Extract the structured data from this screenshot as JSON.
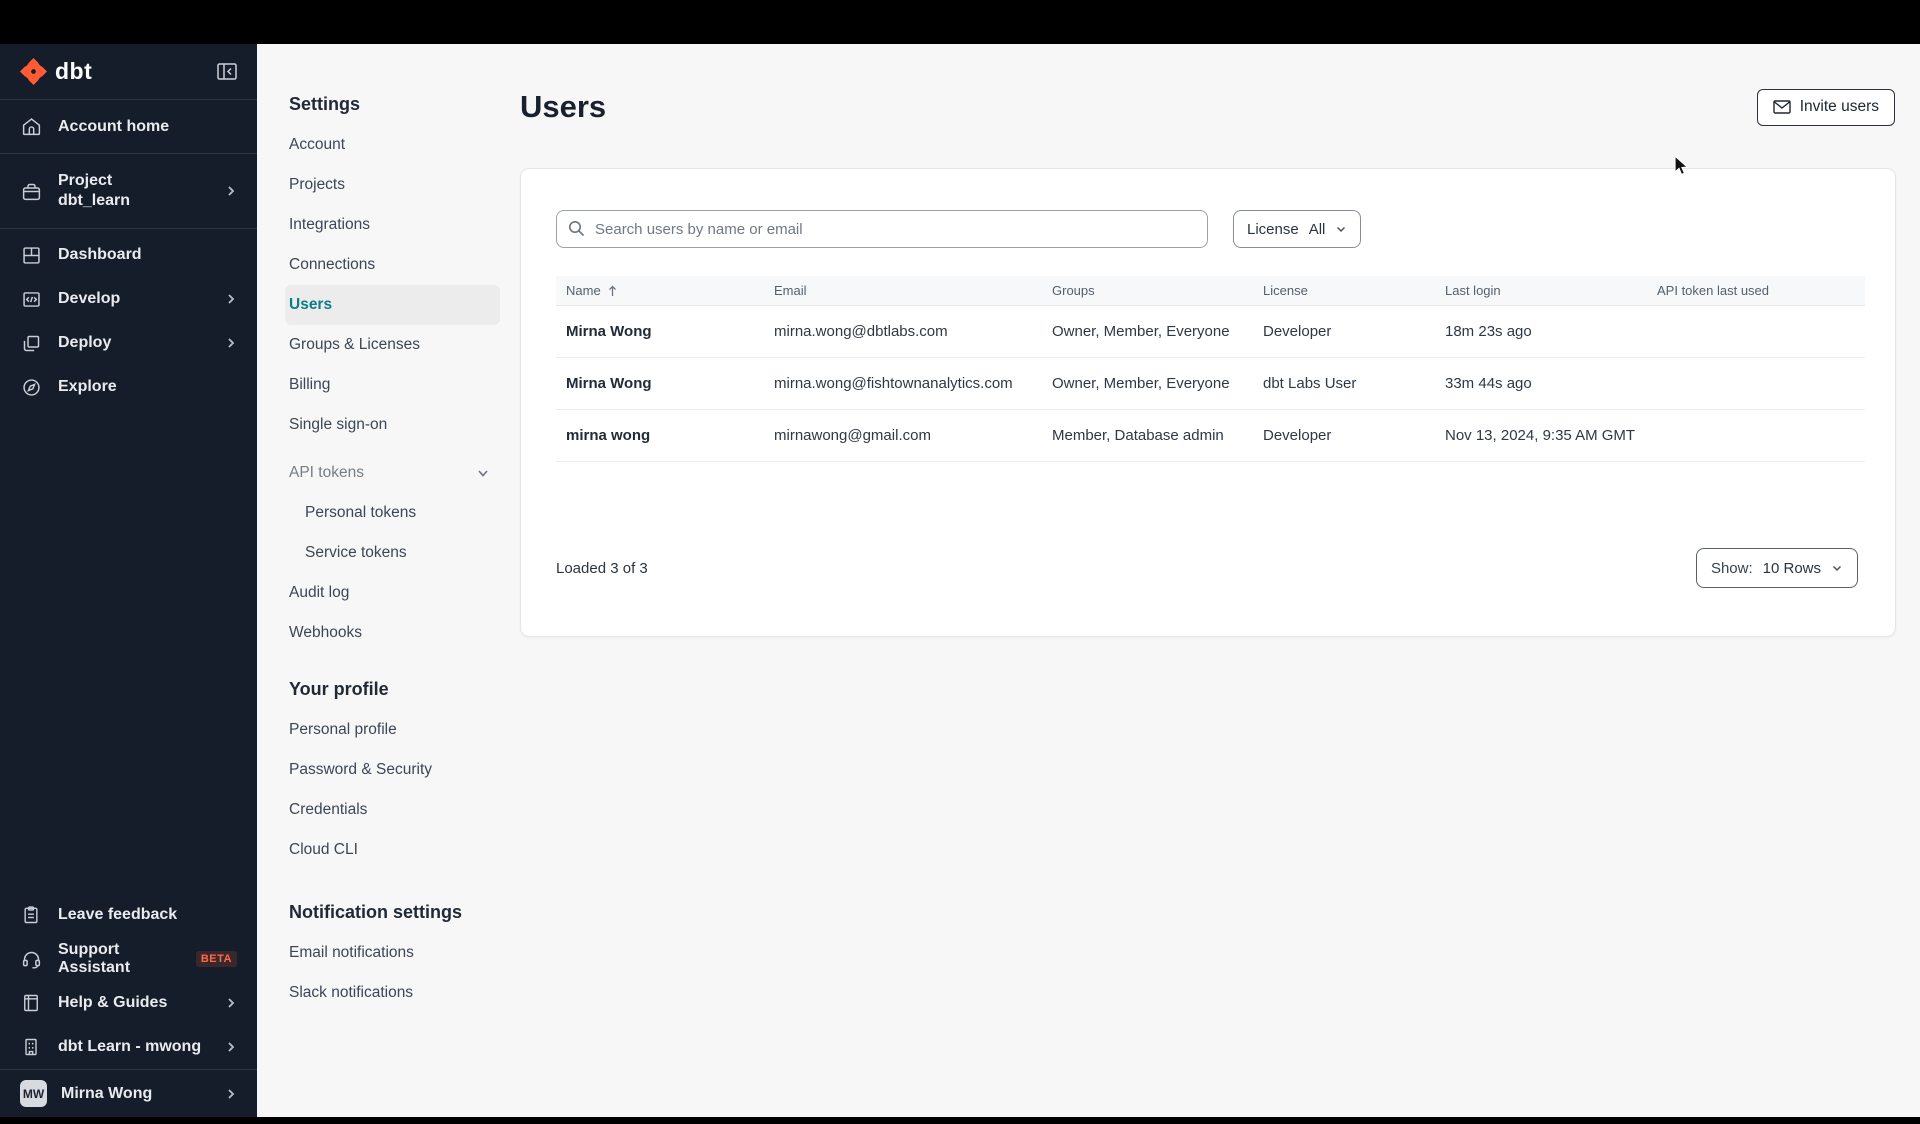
{
  "brand": {
    "logo_text": "dbt",
    "orange": "#ff5c35",
    "teal_selected": "#0d7d88"
  },
  "sidebar": {
    "account_home": "Account home",
    "project_label": "Project",
    "project_name": "dbt_learn",
    "menu": [
      {
        "label": "Dashboard"
      },
      {
        "label": "Develop"
      },
      {
        "label": "Deploy"
      },
      {
        "label": "Explore"
      }
    ],
    "footer": [
      {
        "label": "Leave feedback"
      },
      {
        "label": "Support Assistant",
        "badge": "BETA"
      },
      {
        "label": "Help & Guides"
      },
      {
        "label": "dbt Learn - mwong"
      }
    ],
    "user": {
      "initials": "MW",
      "name": "Mirna Wong"
    }
  },
  "settings_nav": {
    "title": "Settings",
    "items": [
      {
        "label": "Account"
      },
      {
        "label": "Projects"
      },
      {
        "label": "Integrations"
      },
      {
        "label": "Connections"
      },
      {
        "label": "Users"
      },
      {
        "label": "Groups & Licenses"
      },
      {
        "label": "Billing"
      },
      {
        "label": "Single sign-on"
      },
      {
        "label": "API tokens"
      },
      {
        "label": "Personal tokens"
      },
      {
        "label": "Service tokens"
      },
      {
        "label": "Audit log"
      },
      {
        "label": "Webhooks"
      }
    ],
    "profile_title": "Your profile",
    "profile_items": [
      {
        "label": "Personal profile"
      },
      {
        "label": "Password & Security"
      },
      {
        "label": "Credentials"
      },
      {
        "label": "Cloud CLI"
      }
    ],
    "notifications_title": "Notification settings",
    "notification_items": [
      {
        "label": "Email notifications"
      },
      {
        "label": "Slack notifications"
      }
    ]
  },
  "main": {
    "title": "Users",
    "invite_button": "Invite users",
    "search_placeholder": "Search users by name or email",
    "license_filter": {
      "label": "License",
      "value": "All"
    },
    "table": {
      "columns": [
        "Name",
        "Email",
        "Groups",
        "License",
        "Last login",
        "API token last used"
      ],
      "rows": [
        [
          "Mirna Wong",
          "mirna.wong@dbtlabs.com",
          "Owner, Member, Everyone",
          "Developer",
          "18m 23s ago",
          ""
        ],
        [
          "Mirna Wong",
          "mirna.wong@fishtownanalytics.com",
          "Owner, Member, Everyone",
          "dbt Labs User",
          "33m 44s ago",
          ""
        ],
        [
          "mirna wong",
          "mirnawong@gmail.com",
          "Member, Database admin",
          "Developer",
          "Nov 13, 2024, 9:35 AM GMT",
          ""
        ]
      ]
    },
    "footer": {
      "loaded_text": "Loaded 3 of 3",
      "show_label": "Show:",
      "show_value": "10 Rows"
    }
  }
}
